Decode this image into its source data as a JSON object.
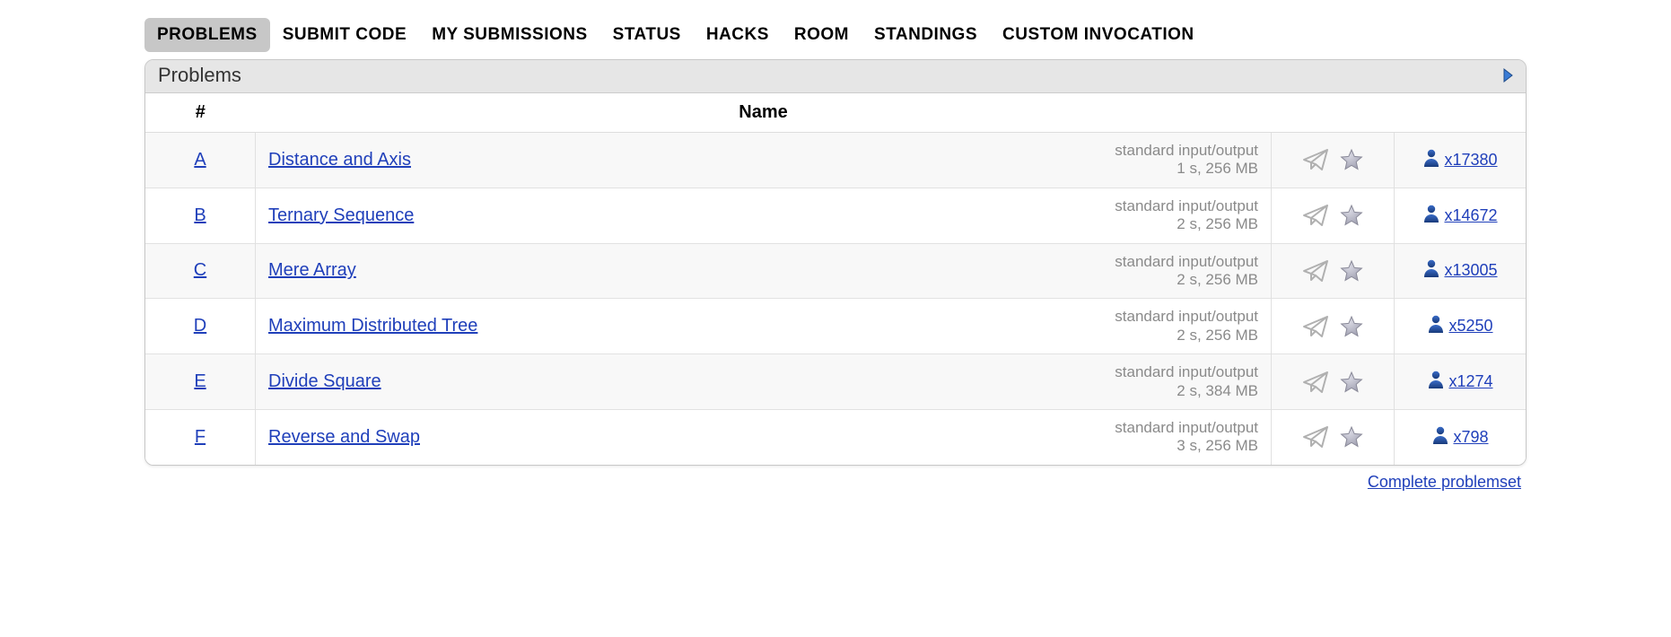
{
  "tabs": [
    {
      "label": "PROBLEMS",
      "active": true
    },
    {
      "label": "SUBMIT CODE",
      "active": false
    },
    {
      "label": "MY SUBMISSIONS",
      "active": false
    },
    {
      "label": "STATUS",
      "active": false
    },
    {
      "label": "HACKS",
      "active": false
    },
    {
      "label": "ROOM",
      "active": false
    },
    {
      "label": "STANDINGS",
      "active": false
    },
    {
      "label": "CUSTOM INVOCATION",
      "active": false
    }
  ],
  "panel": {
    "title": "Problems"
  },
  "headers": {
    "idx": "#",
    "name": "Name"
  },
  "problems": [
    {
      "idx": "A",
      "name": "Distance and Axis",
      "io": "standard input/output",
      "limits": "1 s, 256 MB",
      "solved": "x17380"
    },
    {
      "idx": "B",
      "name": "Ternary Sequence",
      "io": "standard input/output",
      "limits": "2 s, 256 MB",
      "solved": "x14672"
    },
    {
      "idx": "C",
      "name": "Mere Array",
      "io": "standard input/output",
      "limits": "2 s, 256 MB",
      "solved": "x13005"
    },
    {
      "idx": "D",
      "name": "Maximum Distributed Tree",
      "io": "standard input/output",
      "limits": "2 s, 256 MB",
      "solved": "x5250"
    },
    {
      "idx": "E",
      "name": "Divide Square",
      "io": "standard input/output",
      "limits": "2 s, 384 MB",
      "solved": "x1274"
    },
    {
      "idx": "F",
      "name": "Reverse and Swap",
      "io": "standard input/output",
      "limits": "3 s, 256 MB",
      "solved": "x798"
    }
  ],
  "footer": {
    "complete": "Complete problemset"
  },
  "icons": {
    "submit": "submit-icon",
    "star": "star-icon",
    "person": "person-icon",
    "expand": "expand-arrow-icon"
  }
}
